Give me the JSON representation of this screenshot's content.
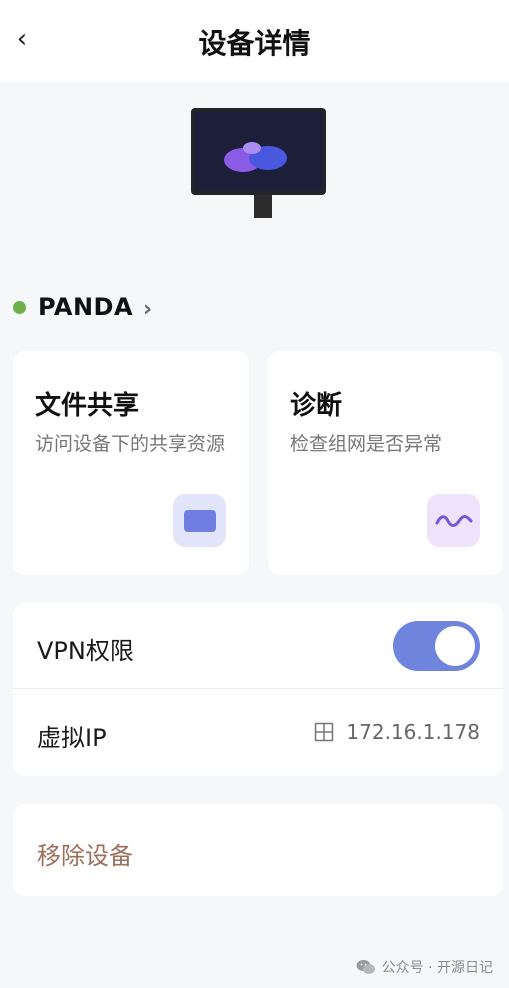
{
  "header": {
    "back_icon": "chevron-left-icon",
    "back_glyph": "‹",
    "title": "设备详情"
  },
  "device": {
    "name": "PANDA",
    "status_color": "#6fb04a",
    "chevron_glyph": "›"
  },
  "cards": {
    "file_share": {
      "title": "文件共享",
      "description": "访问设备下的共享资源",
      "icon": "folder-icon"
    },
    "diagnose": {
      "title": "诊断",
      "description": "检查组网是否异常",
      "icon": "wave-icon"
    }
  },
  "settings": {
    "vpn": {
      "label": "VPN权限",
      "enabled": true
    },
    "virtual_ip": {
      "label": "虚拟IP",
      "value": "172.16.1.178",
      "icon": "grid-icon"
    }
  },
  "remove": {
    "label": "移除设备"
  },
  "watermark": {
    "text": "公众号 · 开源日记",
    "icon": "wechat-icon"
  },
  "colors": {
    "accent": "#6f84dd",
    "remove_text": "#9b6f5c",
    "background": "#f6f7f9"
  }
}
